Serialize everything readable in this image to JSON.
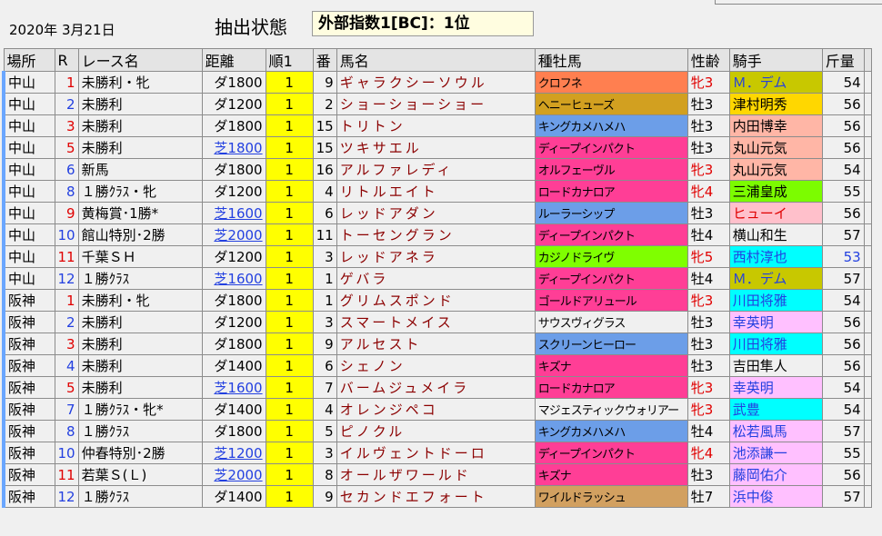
{
  "header": {
    "date": "2020年 3月21日",
    "state_label": "抽出状態",
    "filter_value": "外部指数1[BC]：1位"
  },
  "columns": [
    "場所",
    "R",
    "レース名",
    "距離",
    "順1",
    "番",
    "馬名",
    "種牡馬",
    "性齢",
    "騎手",
    "斤量"
  ],
  "rows": [
    {
      "place": "中山",
      "r": "1",
      "race": "未勝利・牝",
      "dist": "ダ1800",
      "turf": false,
      "rank": "1",
      "ban": "9",
      "horse": "ギャラクシーソウル",
      "sire": "クロフネ",
      "sire_bg": "#ff7f50",
      "sex": "牝3",
      "female": true,
      "jockey": "Ｍ．デム",
      "jockey_bg": "#c8c800",
      "jockey_color": "#2340e0",
      "wt": "54",
      "wt_color": "#000"
    },
    {
      "place": "中山",
      "r": "2",
      "race": "未勝利",
      "dist": "ダ1200",
      "turf": false,
      "rank": "1",
      "ban": "2",
      "horse": "ショーショーショー",
      "sire": "ヘニーヒューズ",
      "sire_bg": "#d2a020",
      "sex": "牡3",
      "female": false,
      "jockey": "津村明秀",
      "jockey_bg": "#ffd700",
      "jockey_color": "#000",
      "wt": "56",
      "wt_color": "#000"
    },
    {
      "place": "中山",
      "r": "3",
      "race": "未勝利",
      "dist": "ダ1800",
      "turf": false,
      "rank": "1",
      "ban": "15",
      "horse": "トリトン",
      "sire": "キングカメハメハ",
      "sire_bg": "#6c9ee8",
      "sex": "牡3",
      "female": false,
      "jockey": "内田博幸",
      "jockey_bg": "#ffb6a6",
      "jockey_color": "#000",
      "wt": "56",
      "wt_color": "#000"
    },
    {
      "place": "中山",
      "r": "5",
      "race": "未勝利",
      "dist": "芝1800",
      "turf": true,
      "rank": "1",
      "ban": "15",
      "horse": "ツキサエル",
      "sire": "ディープインパクト",
      "sire_bg": "#ff3e96",
      "sex": "牡3",
      "female": false,
      "jockey": "丸山元気",
      "jockey_bg": "#ffb6a6",
      "jockey_color": "#000",
      "wt": "56",
      "wt_color": "#000"
    },
    {
      "place": "中山",
      "r": "6",
      "race": "新馬",
      "dist": "ダ1800",
      "turf": false,
      "rank": "1",
      "ban": "16",
      "horse": "アルファレディ",
      "sire": "オルフェーヴル",
      "sire_bg": "#ff3e96",
      "sex": "牝3",
      "female": true,
      "jockey": "丸山元気",
      "jockey_bg": "#ffb6a6",
      "jockey_color": "#000",
      "wt": "54",
      "wt_color": "#000"
    },
    {
      "place": "中山",
      "r": "8",
      "race": "１勝ｸﾗｽ・牝",
      "dist": "ダ1200",
      "turf": false,
      "rank": "1",
      "ban": "4",
      "horse": "リトルエイト",
      "sire": "ロードカナロア",
      "sire_bg": "#ff3e96",
      "sex": "牝4",
      "female": true,
      "jockey": "三浦皇成",
      "jockey_bg": "#7cfc00",
      "jockey_color": "#000",
      "wt": "55",
      "wt_color": "#000"
    },
    {
      "place": "中山",
      "r": "9",
      "race": "黄梅賞･1勝*",
      "dist": "芝1600",
      "turf": true,
      "rank": "1",
      "ban": "6",
      "horse": "レッドアダン",
      "sire": "ルーラーシップ",
      "sire_bg": "#6c9ee8",
      "sex": "牡3",
      "female": false,
      "jockey": "ヒューイ",
      "jockey_bg": "#ffc0cb",
      "jockey_color": "#e00000",
      "wt": "56",
      "wt_color": "#000"
    },
    {
      "place": "中山",
      "r": "10",
      "race": "館山特別･2勝",
      "dist": "芝2000",
      "turf": true,
      "rank": "1",
      "ban": "11",
      "horse": "トーセングラン",
      "sire": "ディープインパクト",
      "sire_bg": "#ff3e96",
      "sex": "牡4",
      "female": false,
      "jockey": "横山和生",
      "jockey_bg": "#f0f0f0",
      "jockey_color": "#000",
      "wt": "57",
      "wt_color": "#000"
    },
    {
      "place": "中山",
      "r": "11",
      "race": "千葉ＳＨ",
      "dist": "ダ1200",
      "turf": false,
      "rank": "1",
      "ban": "3",
      "horse": "レッドアネラ",
      "sire": "カジノドライヴ",
      "sire_bg": "#7fff00",
      "sex": "牝5",
      "female": true,
      "jockey": "西村淳也",
      "jockey_bg": "#00ffff",
      "jockey_color": "#2340e0",
      "wt": "53",
      "wt_color": "#2340e0"
    },
    {
      "place": "中山",
      "r": "12",
      "race": "１勝ｸﾗｽ",
      "dist": "芝1600",
      "turf": true,
      "rank": "1",
      "ban": "1",
      "horse": "ゲバラ",
      "sire": "ディープインパクト",
      "sire_bg": "#ff3e96",
      "sex": "牡4",
      "female": false,
      "jockey": "Ｍ．デム",
      "jockey_bg": "#c8c800",
      "jockey_color": "#2340e0",
      "wt": "57",
      "wt_color": "#000"
    },
    {
      "place": "阪神",
      "r": "1",
      "race": "未勝利・牝",
      "dist": "ダ1800",
      "turf": false,
      "rank": "1",
      "ban": "1",
      "horse": "グリムスポンド",
      "sire": "ゴールドアリュール",
      "sire_bg": "#ff3e96",
      "sex": "牝3",
      "female": true,
      "jockey": "川田将雅",
      "jockey_bg": "#00ffff",
      "jockey_color": "#2340e0",
      "wt": "54",
      "wt_color": "#000"
    },
    {
      "place": "阪神",
      "r": "2",
      "race": "未勝利",
      "dist": "ダ1200",
      "turf": false,
      "rank": "1",
      "ban": "3",
      "horse": "スマートメイス",
      "sire": "サウスヴィグラス",
      "sire_bg": "#f0f0f0",
      "sex": "牡3",
      "female": false,
      "jockey": "幸英明",
      "jockey_bg": "#ffc0ff",
      "jockey_color": "#2340e0",
      "wt": "56",
      "wt_color": "#000"
    },
    {
      "place": "阪神",
      "r": "3",
      "race": "未勝利",
      "dist": "ダ1800",
      "turf": false,
      "rank": "1",
      "ban": "9",
      "horse": "アルセスト",
      "sire": "スクリーンヒーロー",
      "sire_bg": "#6c9ee8",
      "sex": "牡3",
      "female": false,
      "jockey": "川田将雅",
      "jockey_bg": "#00ffff",
      "jockey_color": "#2340e0",
      "wt": "56",
      "wt_color": "#000"
    },
    {
      "place": "阪神",
      "r": "4",
      "race": "未勝利",
      "dist": "ダ1400",
      "turf": false,
      "rank": "1",
      "ban": "6",
      "horse": "シェノン",
      "sire": "キズナ",
      "sire_bg": "#ff3e96",
      "sex": "牡3",
      "female": false,
      "jockey": "吉田隼人",
      "jockey_bg": "#f0f0f0",
      "jockey_color": "#000",
      "wt": "56",
      "wt_color": "#000"
    },
    {
      "place": "阪神",
      "r": "5",
      "race": "未勝利",
      "dist": "芝1600",
      "turf": true,
      "rank": "1",
      "ban": "7",
      "horse": "バームジュメイラ",
      "sire": "ロードカナロア",
      "sire_bg": "#ff3e96",
      "sex": "牝3",
      "female": true,
      "jockey": "幸英明",
      "jockey_bg": "#ffc0ff",
      "jockey_color": "#2340e0",
      "wt": "54",
      "wt_color": "#000"
    },
    {
      "place": "阪神",
      "r": "7",
      "race": "１勝ｸﾗｽ・牝*",
      "dist": "ダ1400",
      "turf": false,
      "rank": "1",
      "ban": "4",
      "horse": "オレンジペコ",
      "sire": "マジェスティックウォリアー",
      "sire_bg": "#f0f0f0",
      "sex": "牝3",
      "female": true,
      "jockey": "武豊",
      "jockey_bg": "#00ffff",
      "jockey_color": "#2340e0",
      "wt": "54",
      "wt_color": "#000"
    },
    {
      "place": "阪神",
      "r": "8",
      "race": "１勝ｸﾗｽ",
      "dist": "ダ1800",
      "turf": false,
      "rank": "1",
      "ban": "5",
      "horse": "ピノクル",
      "sire": "キングカメハメハ",
      "sire_bg": "#6c9ee8",
      "sex": "牡4",
      "female": false,
      "jockey": "松若風馬",
      "jockey_bg": "#ffc0ff",
      "jockey_color": "#2340e0",
      "wt": "57",
      "wt_color": "#000"
    },
    {
      "place": "阪神",
      "r": "10",
      "race": "仲春特別･2勝",
      "dist": "芝1200",
      "turf": true,
      "rank": "1",
      "ban": "3",
      "horse": "イルヴェントドーロ",
      "sire": "ディープインパクト",
      "sire_bg": "#ff3e96",
      "sex": "牝4",
      "female": true,
      "jockey": "池添謙一",
      "jockey_bg": "#ffc0ff",
      "jockey_color": "#2340e0",
      "wt": "55",
      "wt_color": "#000"
    },
    {
      "place": "阪神",
      "r": "11",
      "race": "若葉Ｓ(Ｌ)",
      "dist": "芝2000",
      "turf": true,
      "rank": "1",
      "ban": "8",
      "horse": "オールザワールド",
      "sire": "キズナ",
      "sire_bg": "#ff3e96",
      "sex": "牡3",
      "female": false,
      "jockey": "藤岡佑介",
      "jockey_bg": "#ffc0ff",
      "jockey_color": "#2340e0",
      "wt": "56",
      "wt_color": "#000"
    },
    {
      "place": "阪神",
      "r": "12",
      "race": "１勝ｸﾗｽ",
      "dist": "ダ1400",
      "turf": false,
      "rank": "1",
      "ban": "9",
      "horse": "セカンドエフォート",
      "sire": "ワイルドラッシュ",
      "sire_bg": "#d2a060",
      "sex": "牡7",
      "female": false,
      "jockey": "浜中俊",
      "jockey_bg": "#ffc0ff",
      "jockey_color": "#2340e0",
      "wt": "57",
      "wt_color": "#000"
    }
  ]
}
